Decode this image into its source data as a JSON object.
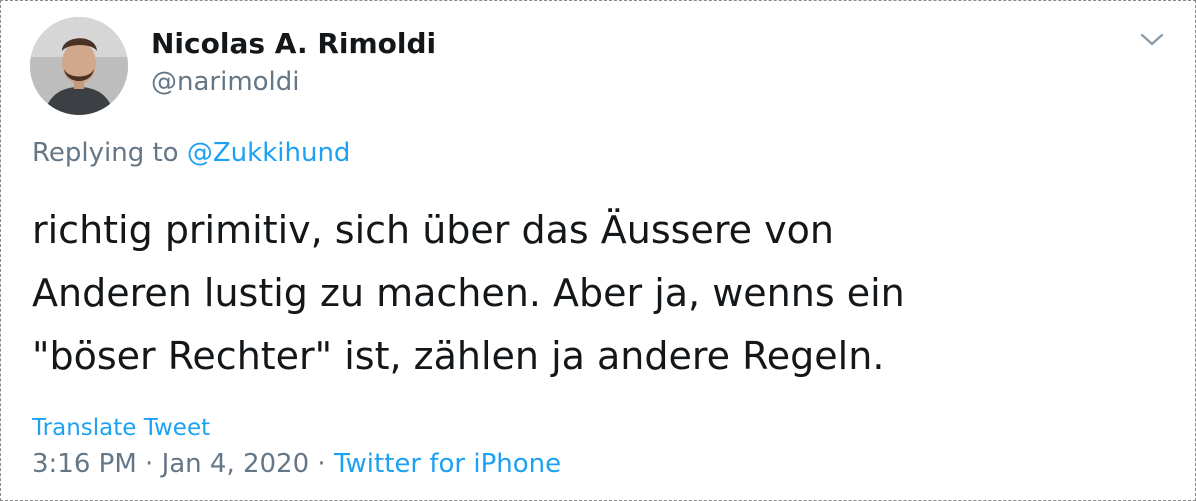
{
  "author": {
    "display_name": "Nicolas A. Rimoldi",
    "handle": "@narimoldi"
  },
  "reply": {
    "prefix": "Replying to",
    "mention": "@Zukkihund"
  },
  "tweet": {
    "lines": [
      "richtig primitiv, sich über das Äussere von",
      "Anderen lustig zu machen. Aber ja, wenns ein",
      "\"böser Rechter\" ist, zählen ja andere Regeln."
    ]
  },
  "translate_label": "Translate Tweet",
  "meta": {
    "time": "3:16 PM",
    "separator": "·",
    "date": "Jan 4, 2020",
    "source": "Twitter for iPhone"
  },
  "icons": {
    "menu": "chevron-down-icon"
  },
  "colors": {
    "text": "#14171a",
    "secondary": "#657786",
    "link": "#1da1f2"
  }
}
